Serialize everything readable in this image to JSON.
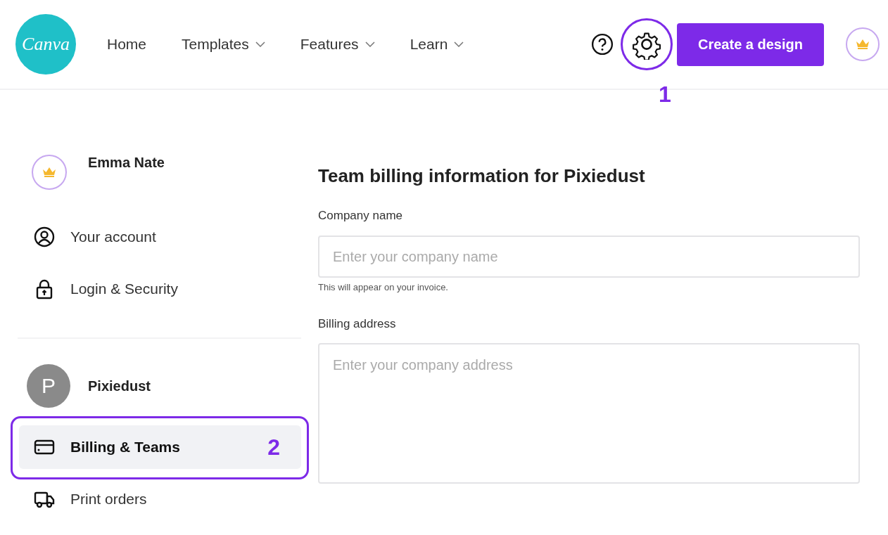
{
  "header": {
    "logo": "Canva",
    "nav": [
      {
        "label": "Home",
        "dropdown": false
      },
      {
        "label": "Templates",
        "dropdown": true
      },
      {
        "label": "Features",
        "dropdown": true
      },
      {
        "label": "Learn",
        "dropdown": true
      }
    ],
    "settings_callout": "1",
    "create_button": "Create a design"
  },
  "sidebar": {
    "user_name": "Emma Nate",
    "account_items": [
      {
        "label": "Your account",
        "selected": false
      },
      {
        "label": "Login & Security",
        "selected": false
      }
    ],
    "team_initial": "P",
    "team_name": "Pixiedust",
    "team_items": [
      {
        "label": "Billing & Teams",
        "selected": true,
        "callout": "2"
      },
      {
        "label": "Print orders",
        "selected": false
      }
    ]
  },
  "main": {
    "title": "Team billing information for Pixiedust",
    "fields": [
      {
        "kind": "input",
        "label": "Company name",
        "placeholder": "Enter your company name",
        "hint": "This will appear on your invoice."
      },
      {
        "kind": "textarea",
        "label": "Billing address",
        "placeholder": "Enter your company address"
      }
    ]
  }
}
